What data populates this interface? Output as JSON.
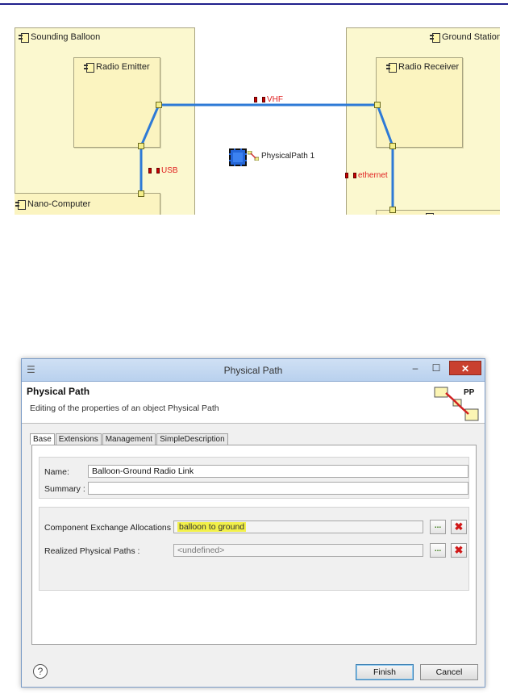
{
  "diagram": {
    "balloon": {
      "title": "Sounding Balloon",
      "emitter": "Radio Emitter",
      "computer": "Nano-Computer"
    },
    "ground": {
      "title": "Ground Station",
      "receiver": "Radio Receiver"
    },
    "links": {
      "vhf": "VHF",
      "usb": "USB",
      "ethernet": "ethernet"
    },
    "physical_path_label": "PhysicalPath 1",
    "link_color": "#2e7ad6",
    "label_color": "#e02020"
  },
  "dialog": {
    "window_title": "Physical Path",
    "window_buttons": {
      "minimize": "–",
      "maximize": "☐",
      "close": "✕"
    },
    "header_title": "Physical Path",
    "header_desc": "Editing of the properties of an object Physical Path",
    "header_logo_text": "PP",
    "tabs": [
      "Base",
      "Extensions",
      "Management",
      "SimpleDescription"
    ],
    "fields": {
      "name_label": "Name:",
      "name_value": "Balloon-Ground Radio Link",
      "summary_label": "Summary :",
      "summary_value": "",
      "cea_label": "Component Exchange Allocations :",
      "cea_value": "balloon to ground",
      "rpp_label": "Realized Physical Paths :",
      "rpp_value": "<undefined>"
    },
    "browse_label": "...",
    "remove_label": "✖",
    "buttons": {
      "finish": "Finish",
      "cancel": "Cancel"
    },
    "help_label": "?"
  }
}
